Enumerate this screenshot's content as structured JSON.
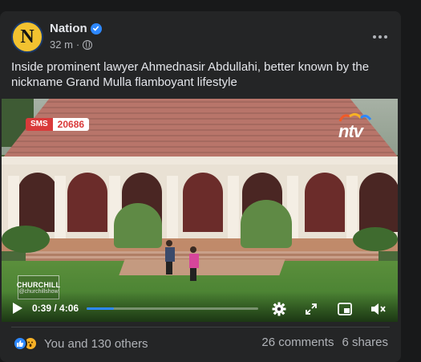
{
  "post": {
    "page_name": "Nation",
    "avatar_letter": "N",
    "time": "32 m",
    "separator": "·",
    "caption": "Inside prominent lawyer Ahmednasir Abdullahi, better known by the nickname Grand Mulla flamboyant lifestyle"
  },
  "video": {
    "sms_label": "SMS",
    "sms_code": "20686",
    "channel_logo": "ntv",
    "watermark_title": "CHURCHILL",
    "watermark_handle": "@churchillshow",
    "current_time": "0:39",
    "duration": "4:06",
    "time_display": "0:39 / 4:06",
    "progress_fraction": 0.158,
    "icons": [
      "play-icon",
      "settings-icon",
      "expand-icon",
      "mini-player-icon",
      "mute-icon"
    ]
  },
  "engagement": {
    "reaction_icons": [
      "like-icon",
      "wow-icon"
    ],
    "reactions_text": "You and 130 others",
    "comments": "26 comments",
    "shares": "6 shares"
  },
  "colors": {
    "card_bg": "#242526",
    "page_bg": "#18191a",
    "accent": "#2d88ff",
    "text_primary": "#e4e6eb",
    "text_secondary": "#b0b3b8"
  }
}
